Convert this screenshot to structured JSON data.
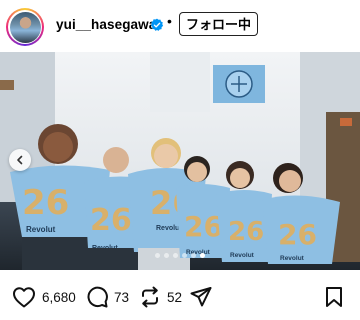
{
  "header": {
    "username": "yui__hasegawa",
    "separator": "•",
    "follow_label": "フォロー中"
  },
  "media": {
    "jersey_number": "26",
    "sponsor": "Revolut",
    "slide_count": 6,
    "active_slide_index": 5
  },
  "actions": {
    "likes": "6,680",
    "comments": "73",
    "reposts": "52"
  },
  "colors": {
    "jersey_sky_blue": "#8ebfe3",
    "number_gold": "#d8b06a",
    "verified_blue": "#0095f6"
  }
}
